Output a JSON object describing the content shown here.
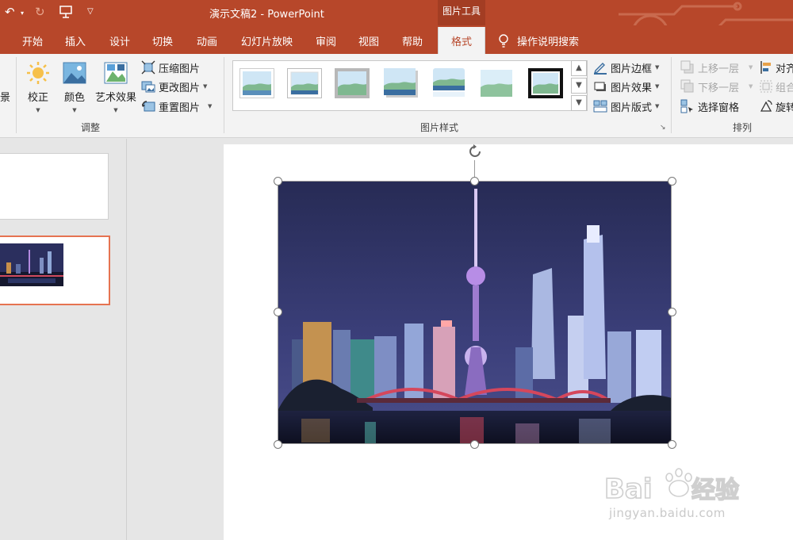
{
  "titlebar": {
    "title": "演示文稿2  -  PowerPoint",
    "tools_tab": "图片工具"
  },
  "tabs": [
    "开始",
    "插入",
    "设计",
    "切换",
    "动画",
    "幻灯片放映",
    "审阅",
    "视图",
    "帮助"
  ],
  "active_tab": "格式",
  "search": {
    "label": "操作说明搜索",
    "icon": "lightbulb-icon"
  },
  "ribbon": {
    "partial_left_label": "景",
    "adjust": {
      "group_label": "调整",
      "corrections": "校正",
      "color": "颜色",
      "artistic": "艺术效果",
      "compress": "压缩图片",
      "change": "更改图片",
      "reset": "重置图片"
    },
    "styles": {
      "group_label": "图片样式",
      "border": "图片边框",
      "effects": "图片效果",
      "layout": "图片版式"
    },
    "arrange": {
      "group_label": "排列",
      "bring_forward": "上移一层",
      "send_backward": "下移一层",
      "selection_pane": "选择窗格",
      "align": "对齐",
      "group": "组合",
      "rotate": "旋转"
    }
  },
  "watermark": {
    "brand": "Baidu经验",
    "site": "jingyan.baidu.com"
  },
  "colors": {
    "accent": "#b7472a",
    "ribbon_bg": "#f3f3f3",
    "selected_thumb_border": "#e57351"
  }
}
